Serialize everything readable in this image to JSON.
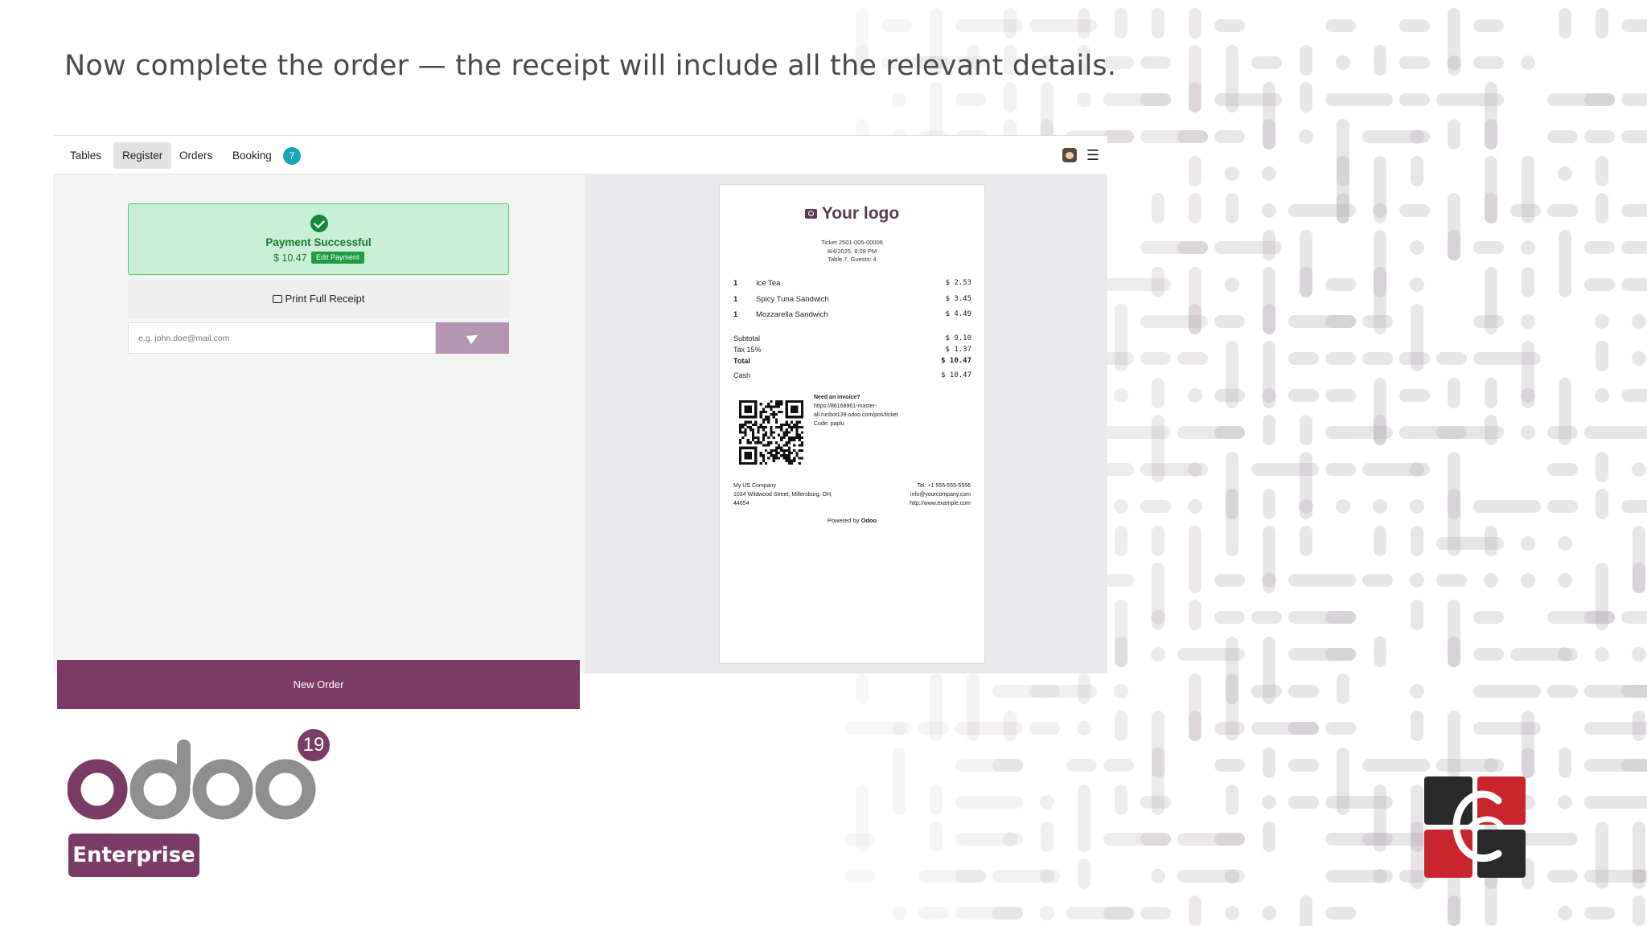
{
  "headline": "Now complete the order — the receipt will include all the relevant details.",
  "nav": {
    "tabs": [
      {
        "label": "Tables"
      },
      {
        "label": "Register"
      },
      {
        "label": "Orders"
      },
      {
        "label": "Booking"
      }
    ],
    "active_tab": "Register",
    "booking_count": "7",
    "avatar_icon": "user-avatar",
    "menu_icon": "hamburger-menu-icon"
  },
  "payment": {
    "status": "Payment Successful",
    "amount": "$ 10.47",
    "edit_label": "Edit Payment"
  },
  "print_label": "Print Full Receipt",
  "email": {
    "placeholder": "e.g. john.doe@mail.com",
    "value": ""
  },
  "new_order_label": "New Order",
  "receipt": {
    "logo_text": "Your logo",
    "ticket": "Ticket 2501-005-00006",
    "datetime": "8/4/2025, 8:09 PM",
    "table": "Table 7, Guests: 4",
    "lines": [
      {
        "qty": "1",
        "name": "Ice Tea",
        "price": "$ 2.53"
      },
      {
        "qty": "1",
        "name": "Spicy Tuna Sandwich",
        "price": "$ 3.45"
      },
      {
        "qty": "1",
        "name": "Mozzarella Sandwich",
        "price": "$ 4.49"
      }
    ],
    "subtotal_label": "Subtotal",
    "subtotal": "$ 9.10",
    "tax_label": "Tax 15%",
    "tax": "$ 1.37",
    "total_label": "Total",
    "total": "$ 10.47",
    "cash_label": "Cash",
    "cash": "$ 10.47",
    "invoice_title": "Need an invoice?",
    "invoice_url_1": "https://86168961-master-",
    "invoice_url_2": "all.runbot139.odoo.com/pos/ticket",
    "invoice_code": "Code: paplu",
    "company_name": "My US Company",
    "company_address_1": "1034 Wildwood Street, Millersburg, OH,",
    "company_address_2": "44654",
    "company_tel": "Tel: +1 555-555-5556",
    "company_email": "info@yourcompany.com",
    "company_web": "http://www.example.com",
    "powered_prefix": "Powered by",
    "powered_brand": "Odoo"
  },
  "branding": {
    "logo_text": "odoo",
    "version": "19",
    "edition": "Enterprise",
    "accent": "#7b3b66",
    "gray": "#8f8f8f"
  }
}
